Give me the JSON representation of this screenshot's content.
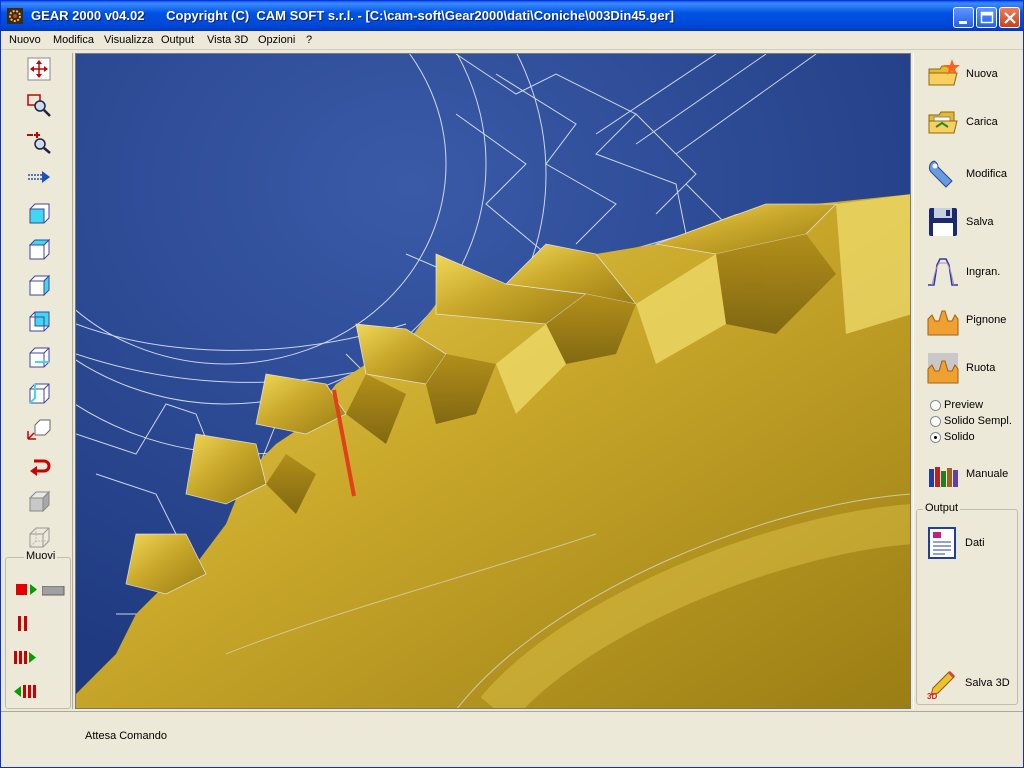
{
  "window": {
    "title": "GEAR 2000 v04.02      Copyright (C)  CAM SOFT s.r.l. - [C:\\cam-soft\\Gear2000\\dati\\Coniche\\003Din45.ger]",
    "app_icon": "gear-app-icon",
    "controls": [
      "minimize-icon",
      "maximize-icon",
      "close-icon"
    ]
  },
  "menu": [
    "Nuovo",
    "Modifica",
    "Visualizza",
    "Output",
    "Vista 3D",
    "Opzioni",
    "?"
  ],
  "left_toolbar": {
    "tools": [
      "move-view-icon",
      "zoom-window-icon",
      "zoom-in-out-icon",
      "pan-right-icon",
      "view-front-icon",
      "view-top-icon",
      "view-right-icon",
      "view-iso1-icon",
      "view-iso2-icon",
      "view-iso3-icon",
      "rotate-axes-icon",
      "undo-view-icon",
      "shaded-box-icon",
      "wireframe-box-icon"
    ],
    "muovi": {
      "label": "Muovi",
      "controls": [
        "record-play-icon",
        "pause-icon",
        "play-forward-icon",
        "play-backward-icon"
      ]
    }
  },
  "right_panel": {
    "buttons": [
      {
        "label": "Nuova",
        "icon": "new-folder-icon"
      },
      {
        "label": "Carica",
        "icon": "open-folder-icon"
      },
      {
        "label": "Modifica",
        "icon": "wrench-icon"
      },
      {
        "label": "Salva",
        "icon": "floppy-disk-icon"
      },
      {
        "label": "Ingran.",
        "icon": "gear-profile-icon"
      },
      {
        "label": "Pignone",
        "icon": "pinion-icon"
      },
      {
        "label": "Ruota",
        "icon": "wheel-icon"
      }
    ],
    "render_modes": [
      {
        "label": "Preview",
        "selected": false
      },
      {
        "label": "Solido Sempl.",
        "selected": false
      },
      {
        "label": "Solido",
        "selected": true
      }
    ],
    "manual": {
      "label": "Manuale",
      "icon": "books-icon"
    },
    "output": {
      "label": "Output",
      "dati": {
        "label": "Dati",
        "icon": "report-icon"
      },
      "salva3d": {
        "label": "Salva 3D",
        "icon": "pencil-3d-icon"
      }
    }
  },
  "status": {
    "text": "Attesa Comando"
  },
  "colors": {
    "viewport_bg": "#2b4590",
    "gear_gold": "#c9a82a",
    "wireframe": "#e8eefc",
    "highlight": "#e0401a"
  }
}
